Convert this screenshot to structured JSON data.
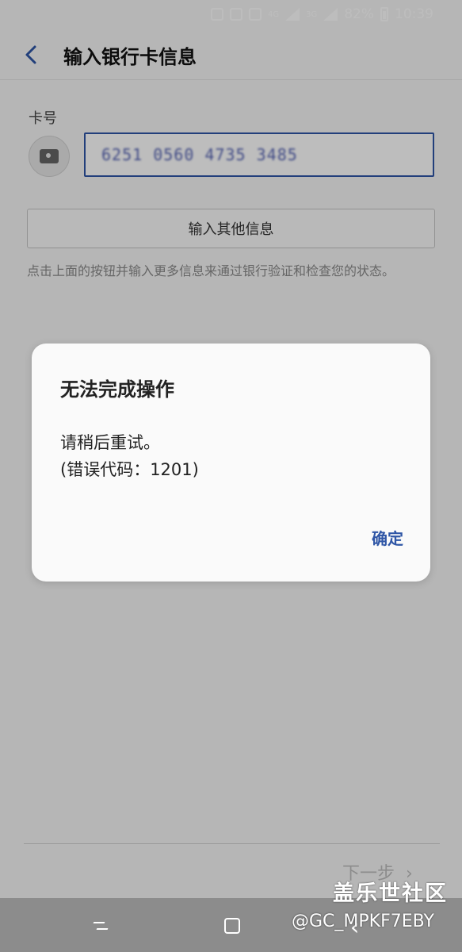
{
  "status_bar": {
    "battery": "82%",
    "time": "10:39",
    "network_a": "4G",
    "network_b": "3G",
    "icons": [
      "gear-icon",
      "nfc-icon",
      "sim-icon",
      "signal-icon",
      "signal-icon",
      "battery-icon"
    ]
  },
  "app_bar": {
    "title": "输入银行卡信息",
    "back_icon": "back-chevron-icon"
  },
  "form": {
    "card_label": "卡号",
    "card_number": "6251 0560 4735 3485",
    "other_info_button": "输入其他信息",
    "hint": "点击上面的按钮并输入更多信息来通过银行验证和检查您的状态。",
    "next_button": "下一步"
  },
  "dialog": {
    "title": "无法完成操作",
    "message_line1": "请稍后重试。",
    "message_line2": "(错误代码：1201)",
    "confirm": "确定"
  },
  "watermark": {
    "brand": "盖乐世社区",
    "user": "@GC_MPKF7EBY"
  },
  "colors": {
    "accent": "#2f56a6",
    "background": "#f6f6f6",
    "dialog_bg": "#fafafa",
    "nav_bg": "#8c8c8c"
  }
}
